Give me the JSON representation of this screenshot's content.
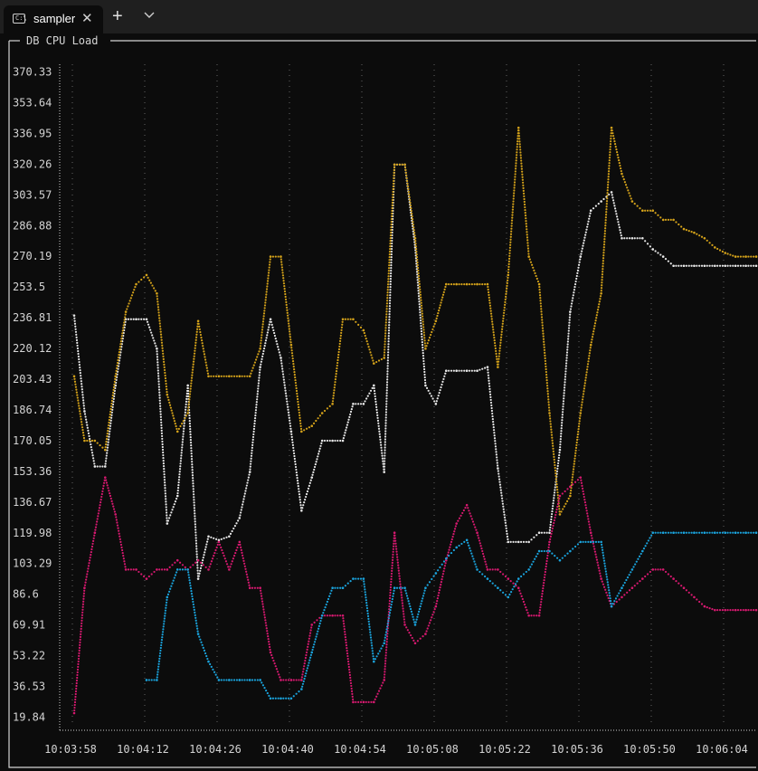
{
  "window": {
    "tab_title": "sampler",
    "tab_icon": "terminal-icon",
    "tab_icon_glyph": "C:\\",
    "close_glyph": "✕",
    "new_tab_glyph": "+",
    "dropdown_icon": "chevron-down-icon"
  },
  "colors": {
    "background": "#0c0c0c",
    "frame": "#d4d4d4",
    "grid": "#555555",
    "series_white": "#e8e8e8",
    "series_orange": "#d4a21a",
    "series_magenta": "#d6196f",
    "series_blue": "#1aa3dc"
  },
  "chart_data": {
    "type": "line",
    "title": "DB CPU Load",
    "xlabel": "",
    "ylabel": "",
    "y_ticks": [
      "370.33",
      "353.64",
      "336.95",
      "320.26",
      "303.57",
      "286.88",
      "270.19",
      "253.5",
      "236.81",
      "220.12",
      "203.43",
      "186.74",
      "170.05",
      "153.36",
      "136.67",
      "119.98",
      "103.29",
      "86.6",
      "69.91",
      "53.22",
      "36.53",
      "19.84"
    ],
    "x_ticks": [
      "10:03:58",
      "10:04:12",
      "10:04:26",
      "10:04:40",
      "10:04:54",
      "10:05:08",
      "10:05:22",
      "10:05:36",
      "10:05:50",
      "10:06:04"
    ],
    "ylim": [
      14,
      378
    ],
    "xlim": [
      0,
      66
    ],
    "grid": true,
    "render_style": "braille",
    "series": [
      {
        "color": "#e8e8e8",
        "x": [
          0,
          1,
          2,
          3,
          4,
          5,
          6,
          7,
          8,
          9,
          10,
          11,
          12,
          13,
          14,
          15,
          16,
          17,
          18,
          19,
          20,
          21,
          22,
          23,
          24,
          25,
          26,
          27,
          28,
          29,
          30,
          31,
          32,
          33,
          34,
          35,
          36,
          37,
          38,
          39,
          40,
          41,
          42,
          43,
          44,
          45,
          46,
          47,
          48,
          49,
          50,
          51,
          52,
          53,
          54,
          55,
          56,
          57,
          58,
          59,
          60,
          61,
          62,
          63,
          64,
          65,
          66
        ],
        "values": [
          238,
          186,
          156,
          156,
          200,
          236,
          236,
          236,
          220,
          125,
          140,
          200,
          95,
          118,
          116,
          118,
          128,
          153,
          210,
          236,
          215,
          175,
          132,
          150,
          170,
          170,
          170,
          190,
          190,
          200,
          153,
          320,
          320,
          275,
          200,
          190,
          208,
          208,
          208,
          208,
          210,
          155,
          115,
          115,
          115,
          120,
          120,
          165,
          240,
          270,
          295,
          300,
          305,
          280,
          280,
          280,
          274,
          270,
          265,
          265,
          265,
          265,
          265,
          265,
          265,
          265,
          265
        ]
      },
      {
        "color": "#d4a21a",
        "x": [
          0,
          1,
          2,
          3,
          4,
          5,
          6,
          7,
          8,
          9,
          10,
          11,
          12,
          13,
          14,
          15,
          16,
          17,
          18,
          19,
          20,
          21,
          22,
          23,
          24,
          25,
          26,
          27,
          28,
          29,
          30,
          31,
          32,
          33,
          34,
          35,
          36,
          37,
          38,
          39,
          40,
          41,
          42,
          43,
          44,
          45,
          46,
          47,
          48,
          49,
          50,
          51,
          52,
          53,
          54,
          55,
          56,
          57,
          58,
          59,
          60,
          61,
          62,
          63,
          64,
          65,
          66
        ],
        "values": [
          205,
          170,
          170,
          165,
          205,
          240,
          255,
          260,
          250,
          195,
          175,
          185,
          235,
          205,
          205,
          205,
          205,
          205,
          220,
          270,
          270,
          222,
          175,
          178,
          185,
          190,
          236,
          236,
          230,
          212,
          215,
          320,
          320,
          280,
          220,
          235,
          255,
          255,
          255,
          255,
          255,
          210,
          260,
          340,
          270,
          255,
          185,
          130,
          140,
          185,
          222,
          250,
          340,
          315,
          300,
          295,
          295,
          290,
          290,
          285,
          283,
          280,
          275,
          272,
          270,
          270,
          270
        ]
      },
      {
        "color": "#d6196f",
        "x": [
          0,
          1,
          2,
          3,
          4,
          5,
          6,
          7,
          8,
          9,
          10,
          11,
          12,
          13,
          14,
          15,
          16,
          17,
          18,
          19,
          20,
          21,
          22,
          23,
          24,
          25,
          26,
          27,
          28,
          29,
          30,
          31,
          32,
          33,
          34,
          35,
          36,
          37,
          38,
          39,
          40,
          41,
          42,
          43,
          44,
          45,
          46,
          47,
          48,
          49,
          50,
          51,
          52,
          53,
          54,
          55,
          56,
          57,
          58,
          59,
          60,
          61,
          62,
          63,
          64,
          65,
          66
        ],
        "values": [
          22,
          90,
          120,
          150,
          130,
          100,
          100,
          95,
          100,
          100,
          105,
          100,
          105,
          100,
          115,
          100,
          115,
          90,
          90,
          55,
          40,
          40,
          40,
          70,
          75,
          75,
          75,
          28,
          28,
          28,
          40,
          120,
          70,
          60,
          65,
          80,
          105,
          125,
          135,
          120,
          100,
          100,
          95,
          90,
          75,
          75,
          115,
          140,
          145,
          150,
          120,
          95,
          80,
          85,
          90,
          95,
          100,
          100,
          95,
          90,
          85,
          80,
          78,
          78,
          78,
          78,
          78
        ]
      },
      {
        "color": "#1aa3dc",
        "x": [
          0,
          1,
          2,
          3,
          4,
          5,
          6,
          7,
          8,
          9,
          10,
          11,
          12,
          13,
          14,
          15,
          16,
          17,
          18,
          19,
          20,
          21,
          22,
          23,
          24,
          25,
          26,
          27,
          28,
          29,
          30,
          31,
          32,
          33,
          34,
          35,
          36,
          37,
          38,
          39,
          40,
          41,
          42,
          43,
          44,
          45,
          46,
          47,
          48,
          49,
          50,
          51,
          52,
          53,
          54,
          55,
          56,
          57,
          58,
          59,
          60,
          61,
          62,
          63,
          64,
          65,
          66
        ],
        "values": [
          null,
          null,
          null,
          null,
          null,
          null,
          null,
          40,
          40,
          85,
          100,
          100,
          65,
          50,
          40,
          40,
          40,
          40,
          40,
          30,
          30,
          30,
          35,
          55,
          75,
          90,
          90,
          95,
          95,
          50,
          60,
          90,
          90,
          70,
          90,
          98,
          106,
          112,
          116,
          100,
          95,
          90,
          85,
          95,
          100,
          110,
          110,
          105,
          110,
          115,
          115,
          115,
          80,
          90,
          100,
          110,
          120,
          120,
          120,
          120,
          120,
          120,
          120,
          120,
          120,
          120,
          120
        ]
      }
    ]
  }
}
